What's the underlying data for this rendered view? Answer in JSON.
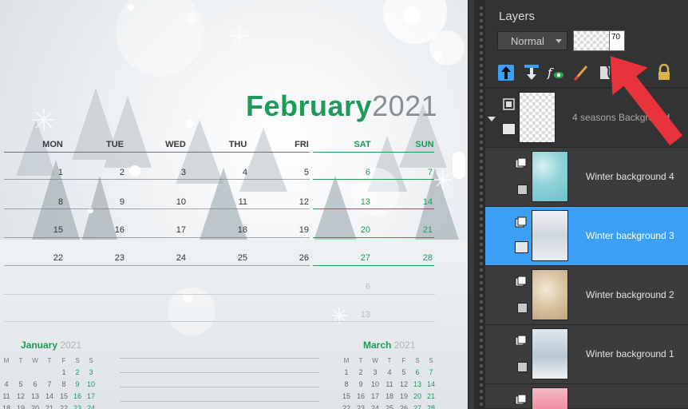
{
  "calendar": {
    "month": "February",
    "year": "2021",
    "weekdays": [
      "MON",
      "TUE",
      "WED",
      "THU",
      "FRI",
      "SAT",
      "SUN"
    ],
    "weeks": [
      [
        "1",
        "2",
        "3",
        "4",
        "5",
        "6",
        "7"
      ],
      [
        "8",
        "9",
        "10",
        "11",
        "12",
        "13",
        "14"
      ],
      [
        "15",
        "16",
        "17",
        "18",
        "19",
        "20",
        "21"
      ],
      [
        "22",
        "23",
        "24",
        "25",
        "26",
        "27",
        "28"
      ]
    ],
    "trailing": [
      [
        "",
        "",
        "",
        "",
        "",
        "6",
        ""
      ],
      [
        "",
        "",
        "",
        "",
        "",
        "13",
        ""
      ]
    ],
    "mini_left": {
      "month": "January",
      "year": "2021",
      "heads": [
        "M",
        "T",
        "W",
        "T",
        "F",
        "S",
        "S"
      ],
      "rows": [
        [
          "",
          "",
          "",
          "",
          "1",
          "2",
          "3"
        ],
        [
          "4",
          "5",
          "6",
          "7",
          "8",
          "9",
          "10"
        ],
        [
          "11",
          "12",
          "13",
          "14",
          "15",
          "16",
          "17"
        ],
        [
          "18",
          "19",
          "20",
          "21",
          "22",
          "23",
          "24"
        ]
      ]
    },
    "mini_right": {
      "month": "March",
      "year": "2021",
      "heads": [
        "M",
        "T",
        "W",
        "T",
        "F",
        "S",
        "S"
      ],
      "rows": [
        [
          "1",
          "2",
          "3",
          "4",
          "5",
          "6",
          "7"
        ],
        [
          "8",
          "9",
          "10",
          "11",
          "12",
          "13",
          "14"
        ],
        [
          "15",
          "16",
          "17",
          "18",
          "19",
          "20",
          "21"
        ],
        [
          "22",
          "23",
          "24",
          "25",
          "26",
          "27",
          "28"
        ]
      ]
    }
  },
  "layers_panel": {
    "title": "Layers",
    "blend_mode": "Normal",
    "opacity": "70",
    "toolbar_icons": [
      "move-layer-up-icon",
      "move-layer-down-icon",
      "fx-effects-icon",
      "paint-brush-icon",
      "layer-style-icon",
      "link-icon",
      "lock-icon"
    ],
    "layers": [
      {
        "name": "4 seasons Background",
        "type": "group",
        "visible": true
      },
      {
        "name": "Winter background 4",
        "visible": false,
        "selected": false
      },
      {
        "name": "Winter background 3",
        "visible": true,
        "selected": true
      },
      {
        "name": "Winter background 2",
        "visible": false,
        "selected": false
      },
      {
        "name": "Winter background 1",
        "visible": false,
        "selected": false
      }
    ]
  },
  "colors": {
    "accent_green": "#1e9a5a",
    "selection_blue": "#3b9ff5",
    "arrow_red": "#e8323c",
    "panel_bg": "#333333"
  }
}
